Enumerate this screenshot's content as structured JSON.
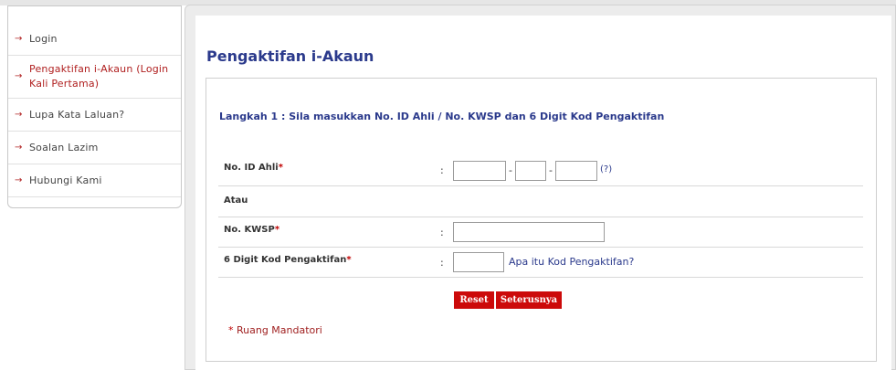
{
  "sidebar": {
    "items": [
      {
        "label": "Login"
      },
      {
        "label": "Pengaktifan i-Akaun (Login Kali Pertama)",
        "active": true
      },
      {
        "label": "Lupa Kata Laluan?"
      },
      {
        "label": "Soalan Lazim"
      },
      {
        "label": "Hubungi Kami"
      }
    ],
    "arrow": "→"
  },
  "page": {
    "title": "Pengaktifan i-Akaun",
    "step": "Langkah 1 : Sila masukkan No. ID Ahli / No. KWSP dan 6 Digit Kod Pengaktifan"
  },
  "form": {
    "colon": ":",
    "required_mark": "*",
    "member_id": {
      "label": "No. ID Ahli",
      "separator": "-",
      "help": "(?)",
      "part1": "",
      "part2": "",
      "part3": ""
    },
    "or_text": "Atau",
    "kwsp": {
      "label": "No. KWSP",
      "value": ""
    },
    "activation_code": {
      "label": "6 Digit Kod Pengaktifan",
      "value": "",
      "help_link": "Apa itu Kod Pengaktifan?"
    },
    "reset_label": "Reset",
    "next_label": "Seterusnya",
    "mandatory_note": "Ruang Mandatori"
  },
  "colors": {
    "accent": "#2b3a8c",
    "button": "#cc0a0a",
    "arrow": "#b02020"
  }
}
